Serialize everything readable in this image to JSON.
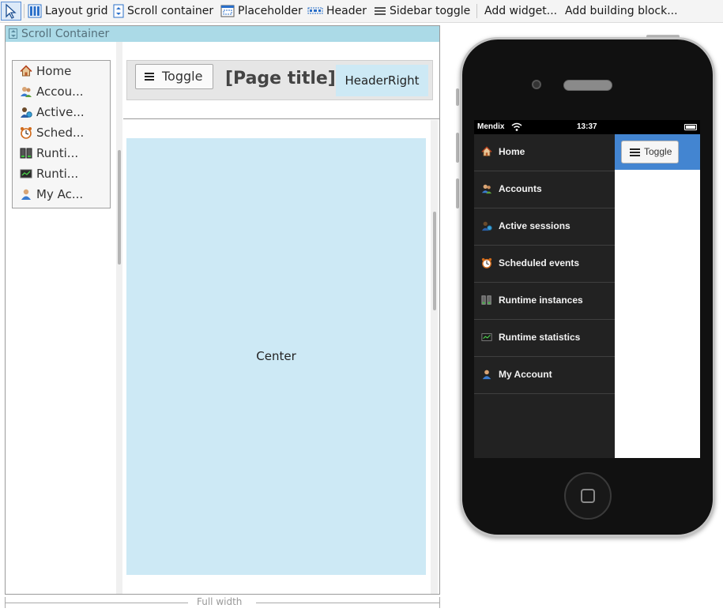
{
  "toolbar": {
    "items": [
      {
        "label": "Layout grid",
        "icon": "layout-grid-icon"
      },
      {
        "label": "Scroll container",
        "icon": "scroll-container-icon"
      },
      {
        "label": "Placeholder",
        "icon": "placeholder-icon"
      },
      {
        "label": "Header",
        "icon": "header-icon"
      },
      {
        "label": "Sidebar toggle",
        "icon": "sidebar-toggle-icon"
      },
      {
        "label": "Add widget..."
      },
      {
        "label": "Add building block..."
      }
    ]
  },
  "canvas": {
    "scroll_container_label": "Scroll Container",
    "width_label": "Full width",
    "sidebar": {
      "items": [
        {
          "label": "Home",
          "icon": "home-icon"
        },
        {
          "label": "Accou...",
          "icon": "accounts-icon"
        },
        {
          "label": "Active...",
          "icon": "active-sessions-icon"
        },
        {
          "label": "Sched...",
          "icon": "scheduled-events-icon"
        },
        {
          "label": "Runti...",
          "icon": "runtime-instances-icon"
        },
        {
          "label": "Runti...",
          "icon": "runtime-statistics-icon"
        },
        {
          "label": "My Ac...",
          "icon": "my-account-icon"
        }
      ]
    },
    "header": {
      "toggle_label": "Toggle",
      "page_title": "[Page title]",
      "header_right": "HeaderRight"
    },
    "center_label": "Center"
  },
  "phone": {
    "status": {
      "carrier": "Mendix",
      "time": "13:37"
    },
    "menu": [
      {
        "label": "Home",
        "icon": "home-icon"
      },
      {
        "label": "Accounts",
        "icon": "accounts-icon"
      },
      {
        "label": "Active sessions",
        "icon": "active-sessions-icon"
      },
      {
        "label": "Scheduled events",
        "icon": "scheduled-events-icon"
      },
      {
        "label": "Runtime instances",
        "icon": "runtime-instances-icon"
      },
      {
        "label": "Runtime statistics",
        "icon": "runtime-statistics-icon"
      },
      {
        "label": "My Account",
        "icon": "my-account-icon"
      }
    ],
    "toggle_label": "Toggle",
    "header_color": "#4385d1"
  },
  "colors": {
    "scroll_container_header": "#abdae7",
    "placeholder_fill": "#cde9f5",
    "phone_menu_bg": "#222222"
  }
}
